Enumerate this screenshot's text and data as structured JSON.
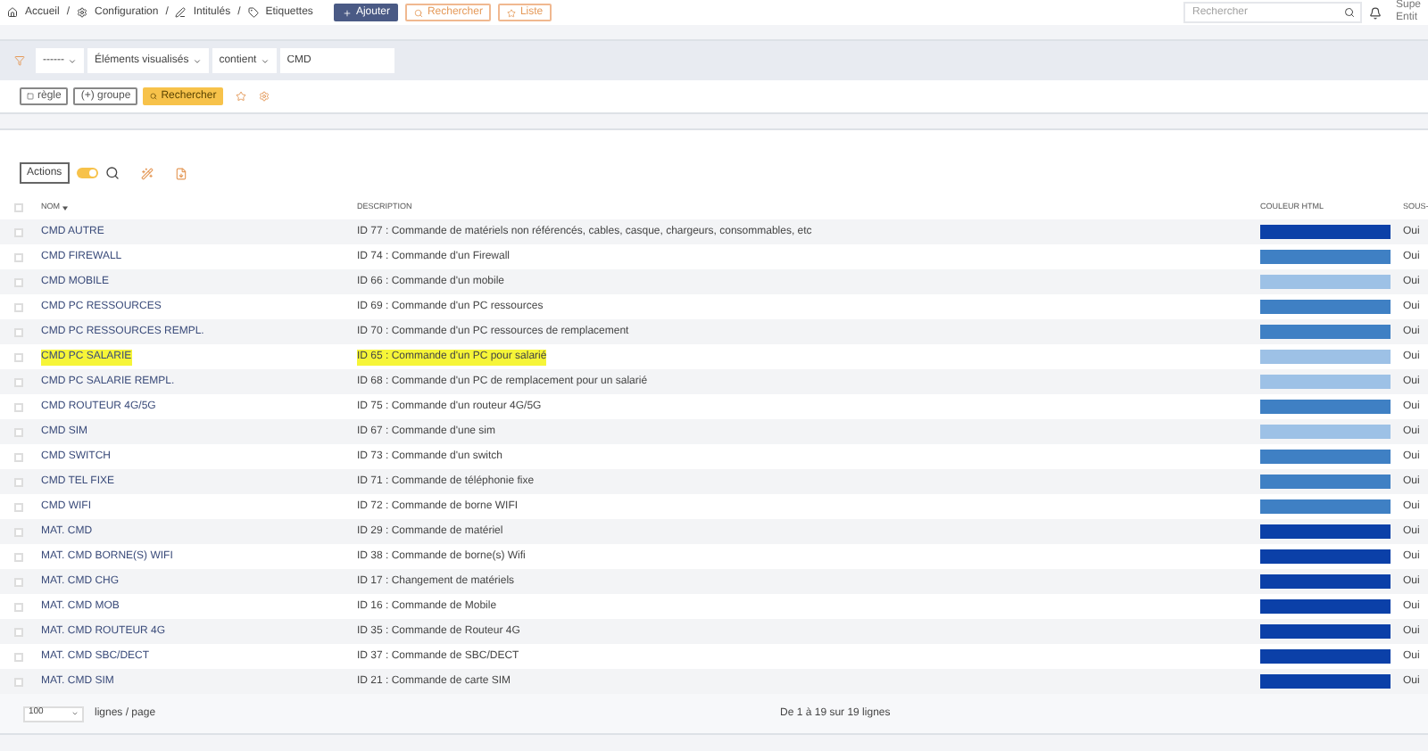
{
  "breadcrumb": [
    "Accueil",
    "Configuration",
    "Intitulés",
    "Etiquettes"
  ],
  "breadcrumb_separator": "/",
  "header_buttons": [
    {
      "label": "Ajouter",
      "kind": "primary"
    },
    {
      "label": "Rechercher",
      "kind": "outline"
    },
    {
      "label": "Liste",
      "kind": "outline"
    }
  ],
  "search": {
    "placeholder": "Rechercher"
  },
  "user": {
    "line_1": "Supe",
    "line_2": "Entit"
  },
  "filter": {
    "selects": [
      "------",
      "Éléments visualisés",
      "contient"
    ],
    "value": "CMD",
    "buttons": [
      {
        "label": "règle",
        "kind": "outline"
      },
      {
        "label": "(+) groupe",
        "kind": "outline"
      },
      {
        "label": "Rechercher",
        "kind": "warning"
      }
    ]
  },
  "toolbar": {
    "actions_label": "Actions",
    "toggle_on": true
  },
  "table": {
    "all_checked": false,
    "columns": [
      "NOM",
      "DESCRIPTION",
      "COULEUR HTML",
      "SOUS-"
    ],
    "rows": [
      {
        "name": "CMD AUTRE",
        "description": "ID 77 : Commande de matériels non référencés, cables, casque, chargeurs, consommables, etc",
        "color": "#0b40a8",
        "sub": "Oui",
        "highlighted": false,
        "checked": false
      },
      {
        "name": "CMD FIREWALL",
        "description": "ID 74 : Commande d'un Firewall",
        "color": "#3f80c4",
        "sub": "Oui",
        "highlighted": false,
        "checked": false
      },
      {
        "name": "CMD MOBILE",
        "description": "ID 66 : Commande d'un mobile",
        "color": "#9dc1e6",
        "sub": "Oui",
        "highlighted": false,
        "checked": false
      },
      {
        "name": "CMD PC RESSOURCES",
        "description": "ID 69 : Commande d'un PC ressources",
        "color": "#3f80c4",
        "sub": "Oui",
        "highlighted": false,
        "checked": false
      },
      {
        "name": "CMD PC RESSOURCES REMPL.",
        "description": "ID 70 : Commande d'un PC ressources de remplacement",
        "color": "#3f80c4",
        "sub": "Oui",
        "highlighted": false,
        "checked": false
      },
      {
        "name": "CMD PC SALARIE",
        "description": "ID 65 : Commande d'un PC pour salarié",
        "color": "#9dc1e6",
        "sub": "Oui",
        "highlighted": true,
        "checked": false
      },
      {
        "name": "CMD PC SALARIE REMPL.",
        "description": "ID 68 : Commande d'un PC de remplacement pour un salarié",
        "color": "#9dc1e6",
        "sub": "Oui",
        "highlighted": false,
        "checked": false
      },
      {
        "name": "CMD ROUTEUR 4G/5G",
        "description": "ID 75 : Commande d'un routeur 4G/5G",
        "color": "#3f80c4",
        "sub": "Oui",
        "highlighted": false,
        "checked": false
      },
      {
        "name": "CMD SIM",
        "description": "ID 67 : Commande d'une sim",
        "color": "#9dc1e6",
        "sub": "Oui",
        "highlighted": false,
        "checked": false
      },
      {
        "name": "CMD SWITCH",
        "description": "ID 73 : Commande d'un switch",
        "color": "#3f80c4",
        "sub": "Oui",
        "highlighted": false,
        "checked": false
      },
      {
        "name": "CMD TEL FIXE",
        "description": "ID 71 : Commande de téléphonie fixe",
        "color": "#3f80c4",
        "sub": "Oui",
        "highlighted": false,
        "checked": false
      },
      {
        "name": "CMD WIFI",
        "description": "ID 72 : Commande de borne WIFI",
        "color": "#3f80c4",
        "sub": "Oui",
        "highlighted": false,
        "checked": false
      },
      {
        "name": "MAT. CMD",
        "description": "ID 29 : Commande de matériel",
        "color": "#0b40a8",
        "sub": "Oui",
        "highlighted": false,
        "checked": false
      },
      {
        "name": "MAT. CMD BORNE(S) WIFI",
        "description": "ID 38 : Commande de borne(s) Wifi",
        "color": "#0b40a8",
        "sub": "Oui",
        "highlighted": false,
        "checked": false
      },
      {
        "name": "MAT. CMD CHG",
        "description": "ID 17 : Changement de matériels",
        "color": "#0b40a8",
        "sub": "Oui",
        "highlighted": false,
        "checked": false
      },
      {
        "name": "MAT. CMD MOB",
        "description": "ID 16 : Commande de Mobile",
        "color": "#0b40a8",
        "sub": "Oui",
        "highlighted": false,
        "checked": false
      },
      {
        "name": "MAT. CMD ROUTEUR 4G",
        "description": "ID 35 : Commande de Routeur 4G",
        "color": "#0b40a8",
        "sub": "Oui",
        "highlighted": false,
        "checked": false
      },
      {
        "name": "MAT. CMD SBC/DECT",
        "description": "ID 37 : Commande de SBC/DECT",
        "color": "#0b40a8",
        "sub": "Oui",
        "highlighted": false,
        "checked": false
      },
      {
        "name": "MAT. CMD SIM",
        "description": "ID 21 : Commande de carte SIM",
        "color": "#0b40a8",
        "sub": "Oui",
        "highlighted": false,
        "checked": false
      }
    ]
  },
  "footer": {
    "page_size": "100",
    "page_size_label": "lignes / page",
    "summary": "De 1 à 19 sur 19 lignes"
  }
}
